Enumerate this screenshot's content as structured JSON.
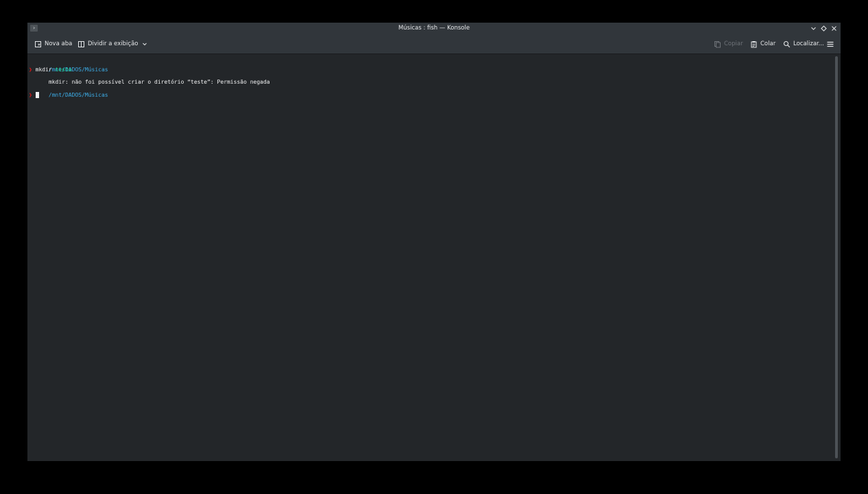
{
  "window": {
    "title": "Músicas : fish — Konsole",
    "icons": {
      "app": "terminal-icon",
      "minimize": "chevron-down-icon",
      "maximize": "diamond-icon",
      "close": "close-icon"
    },
    "app_icon_glyph": "›"
  },
  "toolbar": {
    "new_tab": "Nova aba",
    "split_view": "Dividir a exibição",
    "copy": "Copiar",
    "paste": "Colar",
    "find": "Localizar..."
  },
  "terminal": {
    "line1_path": "/mnt/DADOS/Músicas",
    "line2_prompt": "❯",
    "line2_cmd": " mkdir ",
    "line2_arg": "teste",
    "line3": "mkdir: não foi possível criar o diretório “teste”: Permissão negada",
    "line5_path": "/mnt/DADOS/Músicas",
    "line6_prompt": "❯"
  },
  "colors": {
    "background": "#232629",
    "chrome": "#31363b",
    "path": "#3daee9",
    "prompt": "#ed1515",
    "argument": "#1cdc9a",
    "text": "#eff0f1"
  }
}
